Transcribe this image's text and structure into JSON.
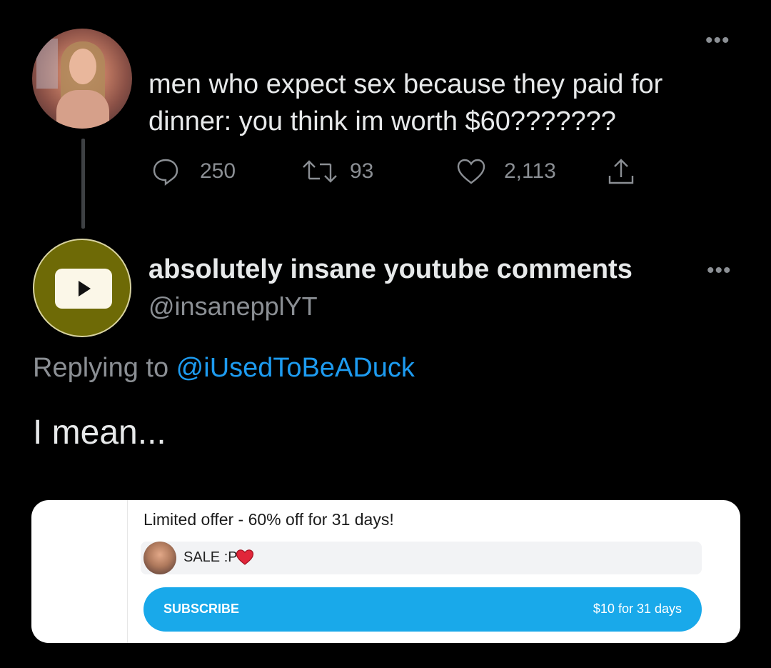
{
  "tweet1": {
    "text_line1": "men who expect sex because they paid for",
    "text_line2": "dinner: you think im worth $60???????",
    "replies": "250",
    "retweets": "93",
    "likes": "2,113",
    "icons": [
      "more-icon",
      "reply-icon",
      "retweet-icon",
      "like-icon",
      "share-icon"
    ]
  },
  "tweet2": {
    "display_name": "absolutely insane youtube comments",
    "handle": "@insanepplYT",
    "replying_prefix": "Replying to ",
    "replying_mention": "@iUsedToBeADuck",
    "body": "I mean...",
    "icons": [
      "more-icon",
      "youtube-play-icon"
    ]
  },
  "card": {
    "offer": "Limited offer - 60% off for 31 days!",
    "sale_text": "SALE :P",
    "subscribe_label": "SUBSCRIBE",
    "price": "$10 for 31 days",
    "icons": [
      "heart-icon"
    ]
  },
  "colors": {
    "background": "#000000",
    "text": "#e7e9ea",
    "muted": "#8b8f94",
    "link": "#1d9bf0",
    "subscribe": "#19a9ea",
    "youtube_avatar": "#6e6a06"
  }
}
